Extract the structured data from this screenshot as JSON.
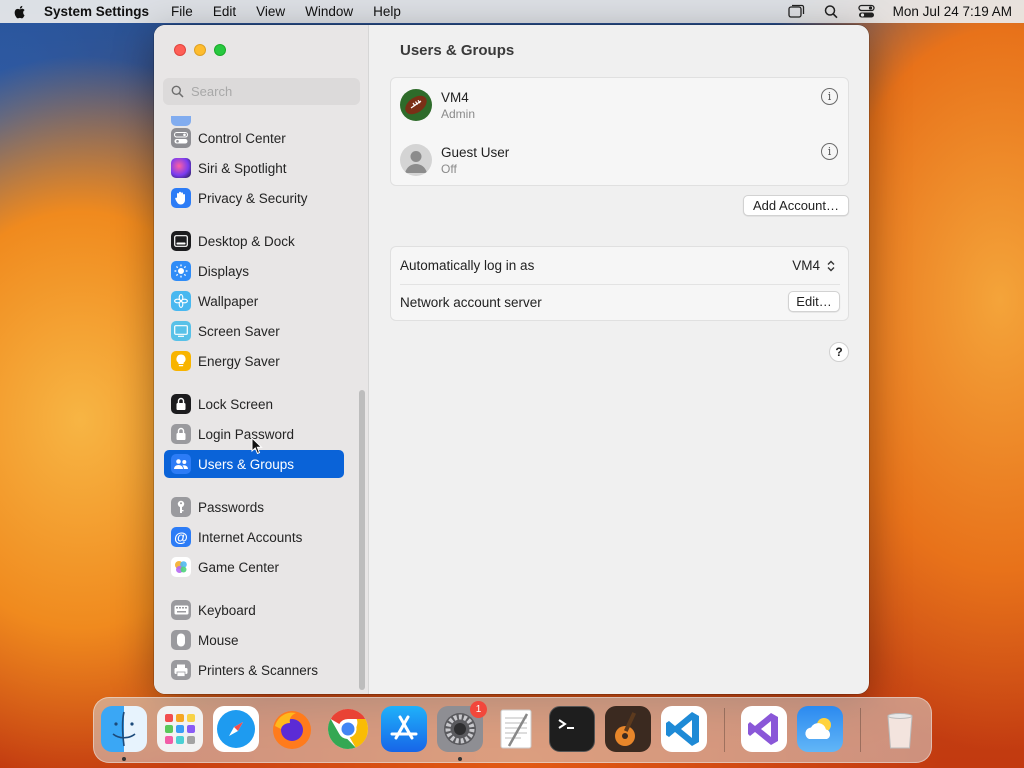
{
  "menubar": {
    "app_name": "System Settings",
    "menus": [
      "File",
      "Edit",
      "View",
      "Window",
      "Help"
    ],
    "datetime": "Mon Jul 24  7:19 AM",
    "status_icons": [
      "window-overview-icon",
      "search-icon",
      "control-center-icon"
    ]
  },
  "search": {
    "placeholder": "Search",
    "value": ""
  },
  "sidebar": {
    "items": [
      {
        "label": "Control Center",
        "icon": "control-center-icon",
        "color": "#8e8e93",
        "selected": false
      },
      {
        "label": "Siri & Spotlight",
        "icon": "siri-icon",
        "color": "#7a3cf0",
        "selected": false
      },
      {
        "label": "Privacy & Security",
        "icon": "hand-icon",
        "color": "#2c7cf6",
        "selected": false
      },
      {
        "label": "Desktop & Dock",
        "icon": "dock-icon",
        "color": "#1c1c1e",
        "selected": false
      },
      {
        "label": "Displays",
        "icon": "sun-icon",
        "color": "#2f8cf7",
        "selected": false
      },
      {
        "label": "Wallpaper",
        "icon": "flower-icon",
        "color": "#49b8f0",
        "selected": false
      },
      {
        "label": "Screen Saver",
        "icon": "screen-saver-icon",
        "color": "#58c1e8",
        "selected": false
      },
      {
        "label": "Energy Saver",
        "icon": "bulb-icon",
        "color": "#f8b400",
        "selected": false
      },
      {
        "label": "Lock Screen",
        "icon": "lock-icon",
        "color": "#1c1c1e",
        "selected": false
      },
      {
        "label": "Login Password",
        "icon": "padlock-icon",
        "color": "#9a9a9e",
        "selected": false
      },
      {
        "label": "Users & Groups",
        "icon": "users-icon",
        "color": "#2c7cf6",
        "selected": true
      },
      {
        "label": "Passwords",
        "icon": "key-icon",
        "color": "#9a9a9e",
        "selected": false
      },
      {
        "label": "Internet Accounts",
        "icon": "at-icon",
        "color": "#2c7cf6",
        "selected": false
      },
      {
        "label": "Game Center",
        "icon": "game-center-icon",
        "color": "#ffffff",
        "selected": false
      },
      {
        "label": "Keyboard",
        "icon": "keyboard-icon",
        "color": "#9a9a9e",
        "selected": false
      },
      {
        "label": "Mouse",
        "icon": "mouse-icon",
        "color": "#9a9a9e",
        "selected": false
      },
      {
        "label": "Printers & Scanners",
        "icon": "printer-icon",
        "color": "#9a9a9e",
        "selected": false
      }
    ]
  },
  "main": {
    "title": "Users & Groups",
    "users": [
      {
        "name": "VM4",
        "role": "Admin",
        "avatar": "football-avatar"
      },
      {
        "name": "Guest User",
        "role": "Off",
        "avatar": "generic-person-avatar"
      }
    ],
    "add_account_label": "Add Account…",
    "auto_login": {
      "label": "Automatically log in as",
      "value": "VM4"
    },
    "network_server": {
      "label": "Network account server",
      "button": "Edit…"
    },
    "help_label": "?"
  },
  "dock": {
    "apps": [
      "Finder",
      "Launchpad",
      "Safari",
      "Firefox",
      "Chrome",
      "App Store",
      "System Settings",
      "TextEdit",
      "Terminal",
      "GarageBand",
      "Visual Studio Code",
      "Visual Studio",
      "Weather",
      "Trash"
    ],
    "settings_badge": "1"
  }
}
